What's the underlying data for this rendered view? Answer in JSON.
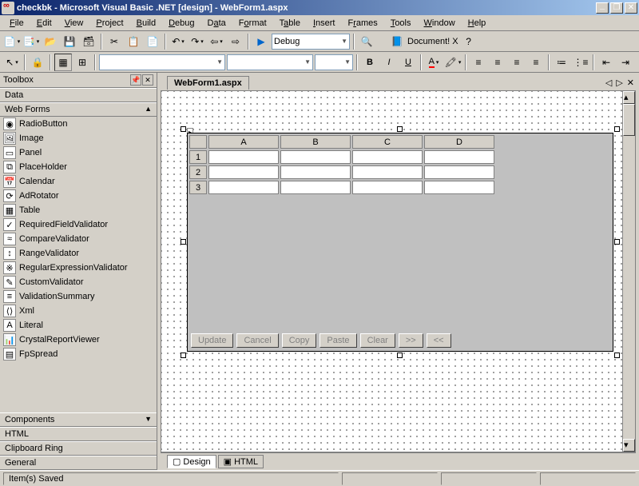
{
  "window": {
    "title": "checkbk - Microsoft Visual Basic .NET [design] - WebForm1.aspx"
  },
  "menu": [
    "File",
    "Edit",
    "View",
    "Project",
    "Build",
    "Debug",
    "Data",
    "Format",
    "Table",
    "Insert",
    "Frames",
    "Tools",
    "Window",
    "Help"
  ],
  "toolbar1": {
    "config_combo": "Debug",
    "doc_label": "Document! X"
  },
  "toolbox": {
    "title": "Toolbox",
    "categories": [
      "Data",
      "Web Forms",
      "Components",
      "HTML",
      "Clipboard Ring",
      "General"
    ],
    "items": [
      {
        "icon": "◉",
        "label": "RadioButton"
      },
      {
        "icon": "🖼",
        "label": "Image"
      },
      {
        "icon": "▭",
        "label": "Panel"
      },
      {
        "icon": "⧉",
        "label": "PlaceHolder"
      },
      {
        "icon": "📅",
        "label": "Calendar"
      },
      {
        "icon": "⟳",
        "label": "AdRotator"
      },
      {
        "icon": "▦",
        "label": "Table"
      },
      {
        "icon": "✓",
        "label": "RequiredFieldValidator"
      },
      {
        "icon": "≈",
        "label": "CompareValidator"
      },
      {
        "icon": "↕",
        "label": "RangeValidator"
      },
      {
        "icon": "※",
        "label": "RegularExpressionValidator"
      },
      {
        "icon": "✎",
        "label": "CustomValidator"
      },
      {
        "icon": "≡",
        "label": "ValidationSummary"
      },
      {
        "icon": "⟨⟩",
        "label": "Xml"
      },
      {
        "icon": "A",
        "label": "Literal"
      },
      {
        "icon": "📊",
        "label": "CrystalReportViewer"
      },
      {
        "icon": "▤",
        "label": "FpSpread"
      }
    ]
  },
  "editor": {
    "tab": "WebForm1.aspx",
    "design_tab": "Design",
    "html_tab": "HTML"
  },
  "spread": {
    "cols": [
      "A",
      "B",
      "C",
      "D"
    ],
    "rows": [
      "1",
      "2",
      "3"
    ],
    "buttons": [
      "Update",
      "Cancel",
      "Copy",
      "Paste",
      "Clear",
      ">>",
      "<<"
    ]
  },
  "status": {
    "text": "Item(s) Saved"
  }
}
